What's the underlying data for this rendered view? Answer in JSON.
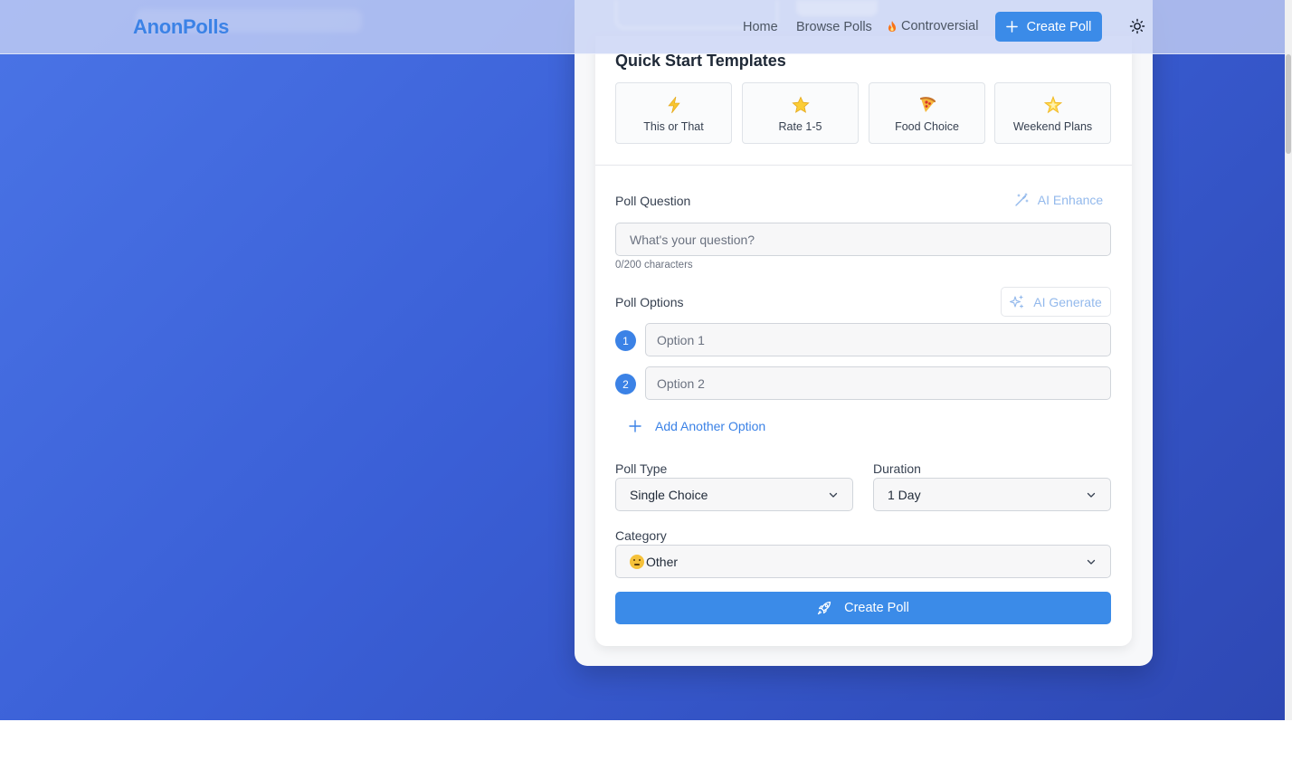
{
  "colors": {
    "accent": "#3b8be8",
    "brand": "#3b82e6",
    "hero_gradient_start": "#4a74e6",
    "hero_gradient_end": "#2e48b4",
    "ai_button_text": "#93b9ec"
  },
  "navbar": {
    "brand": "AnonPolls",
    "links": [
      "Home",
      "Browse Polls"
    ],
    "controversial_label": "Controversial",
    "create_label": "Create Poll",
    "icons": {
      "controversial": "flame-icon",
      "create": "plus-icon",
      "theme": "sun-icon"
    }
  },
  "templates": {
    "title": "Quick Start Templates",
    "items": [
      {
        "label": "This or That",
        "icon": "lightning-icon"
      },
      {
        "label": "Rate 1-5",
        "icon": "star-icon"
      },
      {
        "label": "Food Choice",
        "icon": "pizza-icon"
      },
      {
        "label": "Weekend Plans",
        "icon": "sparkle-star-icon"
      }
    ]
  },
  "question": {
    "label": "Poll Question",
    "ai_enhance_label": "AI Enhance",
    "placeholder": "What's your question?",
    "value": "",
    "char_count": "0/200 characters"
  },
  "options": {
    "label": "Poll Options",
    "ai_generate_label": "AI Generate",
    "items": [
      {
        "number": "1",
        "placeholder": "Option 1",
        "value": ""
      },
      {
        "number": "2",
        "placeholder": "Option 2",
        "value": ""
      }
    ],
    "add_label": "Add Another Option"
  },
  "settings": {
    "poll_type_label": "Poll Type",
    "poll_type_value": "Single Choice",
    "duration_label": "Duration",
    "duration_value": "1 Day",
    "category_label": "Category",
    "category_value": "Other",
    "category_icon": "thinking-face-emoji"
  },
  "submit": {
    "label": "Create Poll",
    "icon": "rocket-icon"
  }
}
